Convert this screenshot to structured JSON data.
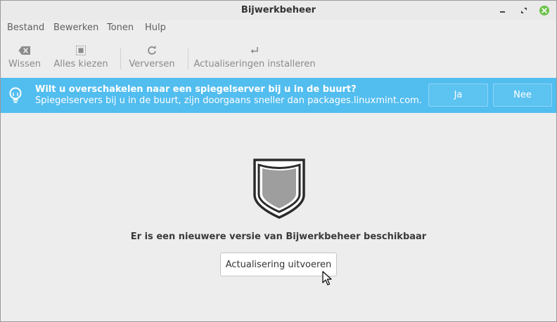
{
  "window": {
    "title": "Bijwerkbeheer",
    "controls": {
      "minimize": "minimize-icon",
      "maximize": "maximize-icon",
      "close": "close-icon"
    }
  },
  "menubar": {
    "items": [
      {
        "label": "Bestand"
      },
      {
        "label": "Bewerken"
      },
      {
        "label": "Tonen"
      },
      {
        "label": "Hulp"
      }
    ]
  },
  "toolbar": {
    "clear": {
      "label": "Wissen",
      "icon": "backspace-icon"
    },
    "select_all": {
      "label": "Alles kiezen",
      "icon": "select-all-icon"
    },
    "refresh": {
      "label": "Verversen",
      "icon": "refresh-icon"
    },
    "install": {
      "label": "Actualiseringen installeren",
      "icon": "enter-icon"
    }
  },
  "infobar": {
    "icon": "lightbulb-icon",
    "title": "Wilt u overschakelen naar een spiegelserver bij u in de buurt?",
    "text": "Spiegelservers bij u in de buurt, zijn doorgaans sneller dan packages.linuxmint.com.",
    "yes_label": "Ja",
    "no_label": "Nee",
    "color": "#52bdef"
  },
  "main": {
    "icon": "shield-icon",
    "message": "Er is een nieuwere versie van Bijwerkbeheer beschikbaar",
    "button_label": "Actualisering uitvoeren"
  },
  "colors": {
    "close_button": "#6cc24a",
    "window_bg": "#ededed"
  }
}
